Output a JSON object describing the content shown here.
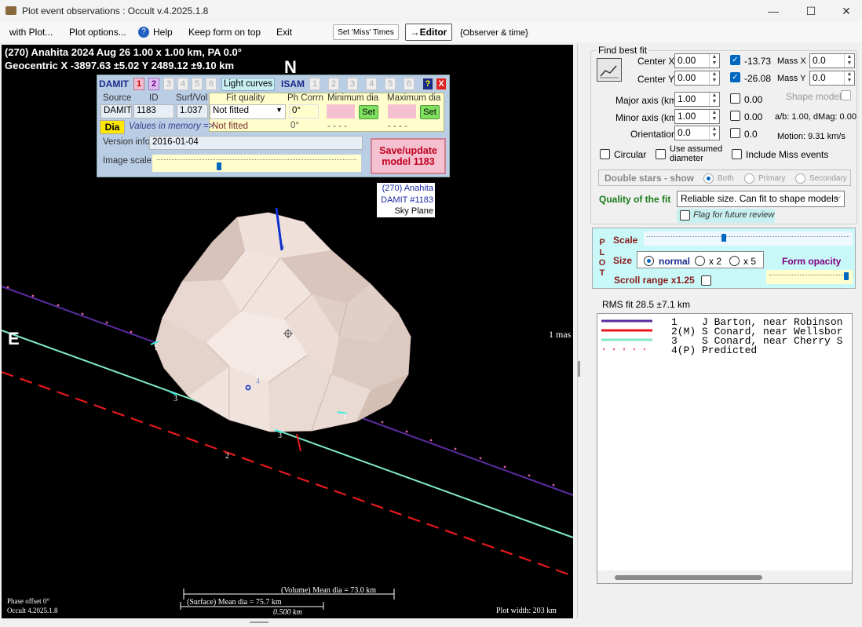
{
  "window": {
    "title": "Plot event observations : Occult v.4.2025.1.8",
    "minimize": "—",
    "maximize": "☐",
    "close": "✕"
  },
  "menu": {
    "with_plot": "with Plot...",
    "plot_options": "Plot options...",
    "help": "Help",
    "keep_on_top": "Keep form on top",
    "exit": "Exit",
    "set_miss_times": "Set 'Miss' Times",
    "editor": "→Editor",
    "observer_time": "{Observer & time}"
  },
  "plot": {
    "header1": "(270) Anahita  2024 Aug 26   1.00 x 1.00 km,  PA 0.0°",
    "header2": "Geocentric  X  -3897.63 ±5.02  Y 2489.12 ±9.10 km",
    "north": "N",
    "east": "E",
    "scale_label": "1 mas",
    "sky_label1": "(270) Anahita",
    "sky_label2": "DAMIT #1183",
    "sky_label3": "Sky Plane",
    "pole_label": "s",
    "chord_label_4": "4",
    "chord_labels": [
      "1",
      "2",
      "3",
      "1",
      "3"
    ],
    "volume_dia": "(Volume) Mean dia = 73.0 km",
    "surface_dia": "(Surface) Mean dia = 75.7 km",
    "scale_bar": "0.500 km",
    "phase_offset": "Phase offset 0°",
    "version": "Occult 4.2025.1.8",
    "plot_width": "Plot width: 203 km"
  },
  "damit": {
    "title": "DAMIT",
    "models": [
      "1",
      "2",
      "3",
      "4",
      "5",
      "6"
    ],
    "light_curves": "Light curves",
    "isam": "ISAM",
    "isam_models": [
      "1",
      "2",
      "3",
      "4",
      "5",
      "6"
    ],
    "help": "?",
    "close": "X",
    "source_hdr": "Source",
    "id_hdr": "ID",
    "surfvol_hdr": "Surf/Vol",
    "source": "DAMIT",
    "id": "1183",
    "surfvol": "1.037",
    "fit_quality_hdr": "Fit quality",
    "phcorr_hdr": "Ph Corrn",
    "min_dia_hdr": "Minimum dia",
    "max_dia_hdr": "Maximum dia",
    "fit_quality": "Not fitted",
    "phcorr": "0°",
    "set": "Set",
    "dia_btn": "Dia",
    "values_in_memory": "Values in memory =>",
    "mem_fit": "Not fitted",
    "mem_ph": "0°",
    "mem_min": "- - - -",
    "mem_max": "- - - -",
    "version_info_lbl": "Version info",
    "version_info": "2016-01-04",
    "image_scale_lbl": "Image scale",
    "save_update": "Save/update model 1183"
  },
  "fit": {
    "find_best_fit": "Find best fit",
    "center_x_lbl": "Center X",
    "center_x": "0.00",
    "center_x_val": "-13.73",
    "center_y_lbl": "Center Y",
    "center_y": "0.00",
    "center_y_val": "-26.08",
    "mass_x_lbl": "Mass X",
    "mass_x": "0.0",
    "mass_y_lbl": "Mass Y",
    "mass_y": "0.0",
    "major_lbl": "Major axis (km)",
    "major": "1.00",
    "major_val": "0.00",
    "minor_lbl": "Minor axis (km)",
    "minor": "1.00",
    "minor_val": "0.00",
    "orient_lbl": "Orientation",
    "orient": "0.0",
    "orient_val": "0.0",
    "shape_model": "Shape model",
    "ab_dmag": "a/b: 1.00, dMag: 0.00",
    "motion": "Motion: 9.31 km/s",
    "circular": "Circular",
    "use_assumed1": "Use assumed",
    "use_assumed2": "diameter",
    "include_miss": "Include Miss events",
    "double_stars": "Double stars - show",
    "both": "Both",
    "primary": "Primary",
    "secondary": "Secondary",
    "quality_lbl": "Quality of the fit",
    "quality": "Reliable size. Can fit to shape models",
    "flag_review": "Flag for future review"
  },
  "plotctl": {
    "p": "P",
    "l": "L",
    "o": "O",
    "t": "T",
    "scale": "Scale",
    "size": "Size",
    "normal": "normal",
    "x2": "x 2",
    "x5": "x 5",
    "form_opacity": "Form opacity",
    "scroll_range": "Scroll range x1.25"
  },
  "rms": "RMS fit 28.5 ±7.1 km",
  "legend": [
    {
      "text": "1    J Barton, near Robinson",
      "color": "#5a2ca0"
    },
    {
      "text": "2(M) S Conard, near Wellsbor",
      "color": "#e8191c"
    },
    {
      "text": "3    S Conard, near Cherry S",
      "color": "#7fe8c8"
    },
    {
      "text": "4(P) Predicted",
      "color": "#e8609c"
    }
  ]
}
